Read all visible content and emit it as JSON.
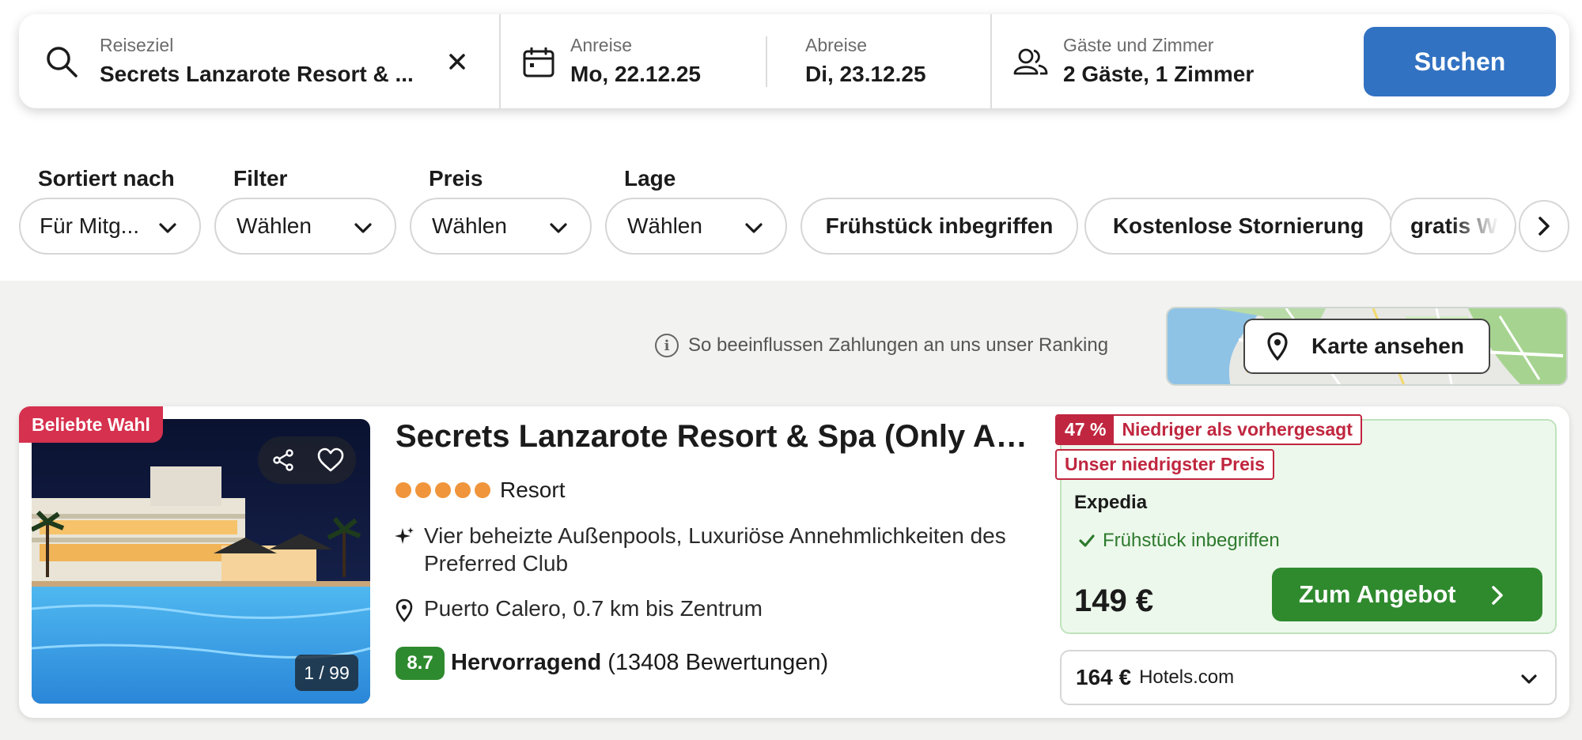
{
  "search": {
    "destination_label": "Reiseziel",
    "destination_value": "Secrets Lanzarote Resort & ...",
    "checkin_label": "Anreise",
    "checkin_value": "Mo, 22.12.25",
    "checkout_label": "Abreise",
    "checkout_value": "Di, 23.12.25",
    "guests_label": "Gäste und Zimmer",
    "guests_value": "2 Gäste, 1 Zimmer",
    "submit_label": "Suchen"
  },
  "filters": {
    "sort_label": "Sortiert nach",
    "sort_value": "Für Mitg...",
    "filter_label": "Filter",
    "filter_value": "Wählen",
    "price_label": "Preis",
    "price_value": "Wählen",
    "location_label": "Lage",
    "location_value": "Wählen",
    "quick_filters": [
      "Frühstück inbegriffen",
      "Kostenlose Stornierung",
      "gratis WLAN"
    ]
  },
  "ranking_info": "So beeinflussen Zahlungen an uns unser Ranking",
  "map_button": "Karte ansehen",
  "result": {
    "badge": "Beliebte Wahl",
    "photo_counter": "1 / 99",
    "title": "Secrets Lanzarote Resort & Spa (Only Ad...",
    "stars": 5,
    "type": "Resort",
    "amenities": "Vier beheizte Außenpools, Luxuriöse Annehmlichkeiten des Preferred Club",
    "location": "Puerto Calero, 0.7 km bis Zentrum",
    "rating_score": "8.7",
    "rating_word": "Hervorragend",
    "rating_count": "(13408 Bewertungen)",
    "deal": {
      "discount_pct": "47 %",
      "discount_text": "Niedriger als vorhergesagt",
      "lowest_price_tag": "Unser niedrigster Preis",
      "provider": "Expedia",
      "breakfast": "Frühstück inbegriffen",
      "price": "149 €",
      "cta": "Zum Angebot"
    },
    "alt_offer": {
      "price": "164 €",
      "provider": "Hotels.com"
    }
  },
  "colors": {
    "primary_blue": "#3272c2",
    "deal_green": "#2f8a2e",
    "alert_red": "#c0263f",
    "badge_red": "#d6314e",
    "star_orange": "#f0953b"
  }
}
